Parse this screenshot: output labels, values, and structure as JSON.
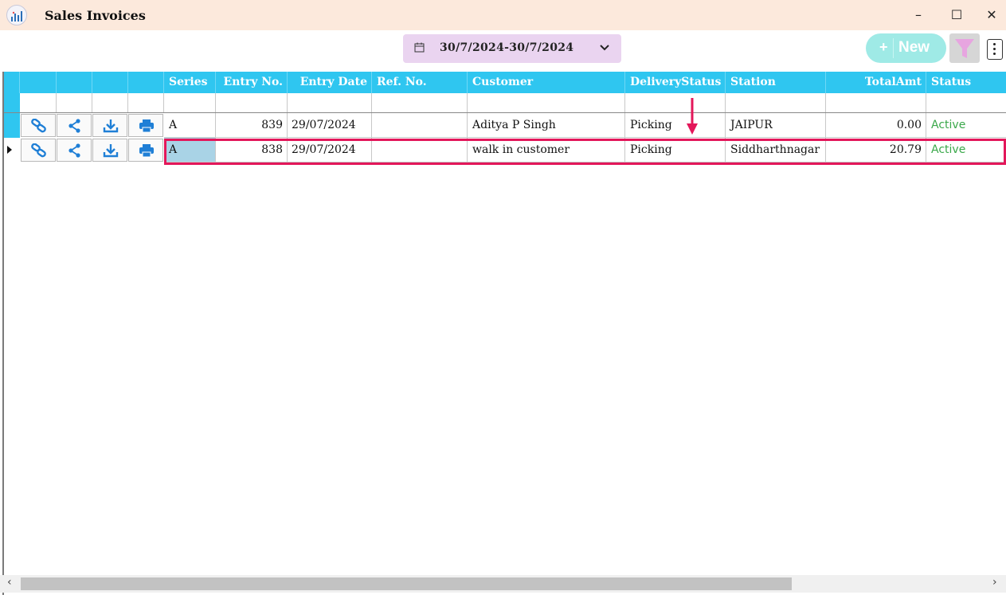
{
  "window": {
    "title": "Sales Invoices",
    "minimize": "–",
    "maximize": "☐",
    "close": "✕"
  },
  "toolbar": {
    "date_range": "30/7/2024-30/7/2024",
    "new_label": "New",
    "new_plus": "+"
  },
  "columns": [
    "Series",
    "Entry No.",
    "Entry Date",
    "Ref. No.",
    "Customer",
    "DeliveryStatus",
    "Station",
    "TotalAmt",
    "Status"
  ],
  "rows": [
    {
      "series": "A",
      "entry_no": "839",
      "entry_date": "29/07/2024",
      "ref_no": "",
      "customer": "Aditya P Singh",
      "delivery_status": "Picking",
      "station": "JAIPUR",
      "total_amt": "0.00",
      "status": "Active"
    },
    {
      "series": "A",
      "entry_no": "838",
      "entry_date": "29/07/2024",
      "ref_no": "",
      "customer": "walk in customer",
      "delivery_status": "Picking",
      "station": "Siddharthnagar",
      "total_amt": "20.79",
      "status": "Active"
    }
  ],
  "colors": {
    "header": "#2fc6f0",
    "title_bar": "#fce9dc",
    "status_active": "#3aa84a",
    "highlight": "#e3175a",
    "action_icon": "#1f7fd6"
  },
  "row_actions": [
    "link-icon",
    "share-icon",
    "download-icon",
    "print-icon"
  ]
}
